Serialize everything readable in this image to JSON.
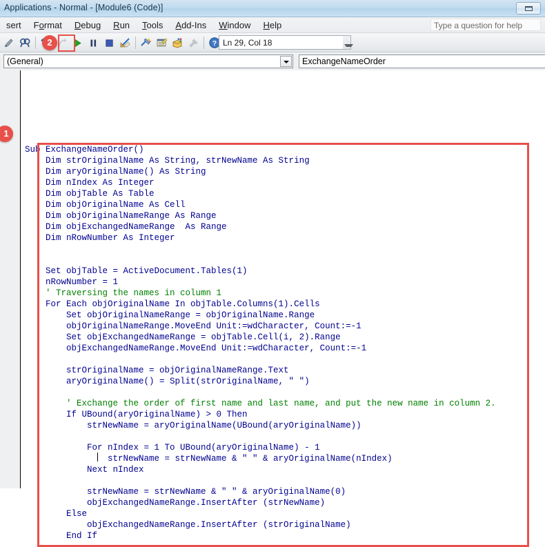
{
  "window": {
    "title": "Applications - Normal - [Module6 (Code)]",
    "restore_button_label": "Restore"
  },
  "menubar": {
    "items": [
      {
        "label": "sert",
        "mnemonic": ""
      },
      {
        "label": "Format",
        "mnemonic": "o"
      },
      {
        "label": "Debug",
        "mnemonic": "D"
      },
      {
        "label": "Run",
        "mnemonic": "R"
      },
      {
        "label": "Tools",
        "mnemonic": "T"
      },
      {
        "label": "Add-Ins",
        "mnemonic": "A"
      },
      {
        "label": "Window",
        "mnemonic": "W"
      },
      {
        "label": "Help",
        "mnemonic": "H"
      }
    ],
    "help_placeholder": "Type a question for help"
  },
  "toolbar": {
    "status_value": "Ln 29, Col 18",
    "icons": [
      "design-mode-icon",
      "find-icon",
      "undo-icon",
      "redo-icon",
      "run-sub-icon",
      "break-icon",
      "reset-icon",
      "design-mode-toggle-icon",
      "project-explorer-icon",
      "properties-window-icon",
      "object-browser-icon",
      "toolbox-icon",
      "help-icon"
    ]
  },
  "combos": {
    "object_value": "(General)",
    "procedure_value": "ExchangeNameOrder"
  },
  "callouts": {
    "one": "1",
    "two": "2"
  },
  "code": {
    "lines": [
      {
        "text": "Sub ExchangeNameOrder()",
        "comment": false
      },
      {
        "text": "    Dim strOriginalName As String, strNewName As String",
        "comment": false
      },
      {
        "text": "    Dim aryOriginalName() As String",
        "comment": false
      },
      {
        "text": "    Dim nIndex As Integer",
        "comment": false
      },
      {
        "text": "    Dim objTable As Table",
        "comment": false
      },
      {
        "text": "    Dim objOriginalName As Cell",
        "comment": false
      },
      {
        "text": "    Dim objOriginalNameRange As Range",
        "comment": false
      },
      {
        "text": "    Dim objExchangedNameRange  As Range",
        "comment": false
      },
      {
        "text": "    Dim nRowNumber As Integer",
        "comment": false
      },
      {
        "text": "",
        "comment": false
      },
      {
        "text": "",
        "comment": false
      },
      {
        "text": "    Set objTable = ActiveDocument.Tables(1)",
        "comment": false
      },
      {
        "text": "    nRowNumber = 1",
        "comment": false
      },
      {
        "text": "    ' Traversing the names in column 1",
        "comment": true
      },
      {
        "text": "    For Each objOriginalName In objTable.Columns(1).Cells",
        "comment": false
      },
      {
        "text": "        Set objOriginalNameRange = objOriginalName.Range",
        "comment": false
      },
      {
        "text": "        objOriginalNameRange.MoveEnd Unit:=wdCharacter, Count:=-1",
        "comment": false
      },
      {
        "text": "        Set objExchangedNameRange = objTable.Cell(i, 2).Range",
        "comment": false
      },
      {
        "text": "        objExchangedNameRange.MoveEnd Unit:=wdCharacter, Count:=-1",
        "comment": false
      },
      {
        "text": "",
        "comment": false
      },
      {
        "text": "        strOriginalName = objOriginalNameRange.Text",
        "comment": false
      },
      {
        "text": "        aryOriginalName() = Split(strOriginalName, \" \")",
        "comment": false
      },
      {
        "text": "",
        "comment": false
      },
      {
        "text": "        ' Exchange the order of first name and last name, and put the new name in column 2.",
        "comment": true
      },
      {
        "text": "        If UBound(aryOriginalName) > 0 Then",
        "comment": false
      },
      {
        "text": "            strNewName = aryOriginalName(UBound(aryOriginalName))",
        "comment": false
      },
      {
        "text": "",
        "comment": false
      },
      {
        "text": "            For nIndex = 1 To UBound(aryOriginalName) - 1",
        "comment": false
      },
      {
        "text": "                strNewName = strNewName & \" \" & aryOriginalName(nIndex)",
        "comment": false
      },
      {
        "text": "            Next nIndex",
        "comment": false
      },
      {
        "text": "",
        "comment": false
      },
      {
        "text": "            strNewName = strNewName & \" \" & aryOriginalName(0)",
        "comment": false
      },
      {
        "text": "            objExchangedNameRange.InsertAfter (strNewName)",
        "comment": false
      },
      {
        "text": "        Else",
        "comment": false
      },
      {
        "text": "            objExchangedNameRange.InsertAfter (strOriginalName)",
        "comment": false
      },
      {
        "text": "        End If",
        "comment": false
      }
    ]
  },
  "colors": {
    "keyword": "#00008f",
    "comment": "#008000",
    "callout_red": "#e8504a",
    "titlebar": "#b5d4ea"
  }
}
